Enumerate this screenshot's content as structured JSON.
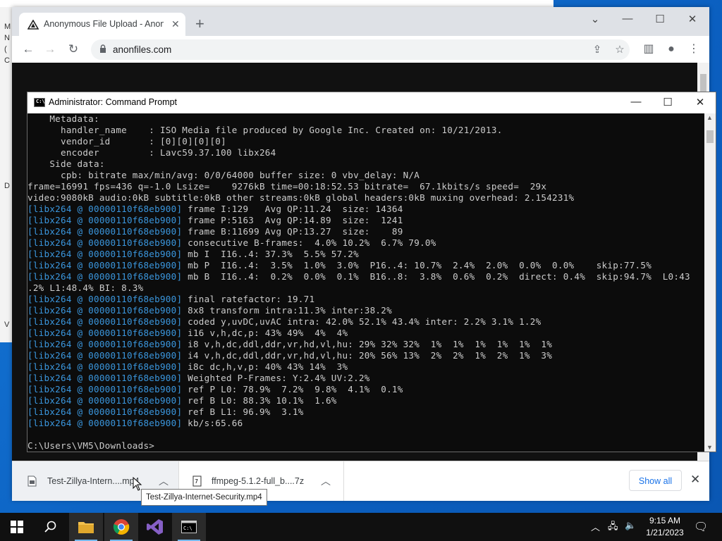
{
  "browser": {
    "tab_title": "Anonymous File Upload - AnonFiles",
    "url": "anonfiles.com",
    "new_tab_label": "+",
    "downloads": [
      {
        "name": "Test-Zillya-Intern....mp4"
      },
      {
        "name": "ffmpeg-5.1.2-full_b....7z"
      }
    ],
    "show_all_label": "Show all",
    "tooltip": "Test-Zillya-Internet-Security.mp4"
  },
  "cmd": {
    "title": "Administrator: Command Prompt",
    "lines": [
      {
        "text": "    Metadata:"
      },
      {
        "text": "      handler_name    : ISO Media file produced by Google Inc. Created on: 10/21/2013."
      },
      {
        "text": "      vendor_id       : [0][0][0][0]"
      },
      {
        "text": "      encoder         : Lavc59.37.100 libx264"
      },
      {
        "text": "    Side data:"
      },
      {
        "text": "      cpb: bitrate max/min/avg: 0/0/64000 buffer size: 0 vbv_delay: N/A"
      },
      {
        "text": "frame=16991 fps=436 q=-1.0 Lsize=    9276kB time=00:18:52.53 bitrate=  67.1kbits/s speed=  29x"
      },
      {
        "text": "video:9080kB audio:0kB subtitle:0kB other streams:0kB global headers:0kB muxing overhead: 2.154231%"
      },
      {
        "prefix": "[libx264 @ 00000110f68eb900]",
        "text": " frame I:129   Avg QP:11.24  size: 14364"
      },
      {
        "prefix": "[libx264 @ 00000110f68eb900]",
        "text": " frame P:5163  Avg QP:14.89  size:  1241"
      },
      {
        "prefix": "[libx264 @ 00000110f68eb900]",
        "text": " frame B:11699 Avg QP:13.27  size:    89"
      },
      {
        "prefix": "[libx264 @ 00000110f68eb900]",
        "text": " consecutive B-frames:  4.0% 10.2%  6.7% 79.0%"
      },
      {
        "prefix": "[libx264 @ 00000110f68eb900]",
        "text": " mb I  I16..4: 37.3%  5.5% 57.2%"
      },
      {
        "prefix": "[libx264 @ 00000110f68eb900]",
        "text": " mb P  I16..4:  3.5%  1.0%  3.0%  P16..4: 10.7%  2.4%  2.0%  0.0%  0.0%    skip:77.5%"
      },
      {
        "prefix": "[libx264 @ 00000110f68eb900]",
        "text": " mb B  I16..4:  0.2%  0.0%  0.1%  B16..8:  3.8%  0.6%  0.2%  direct: 0.4%  skip:94.7%  L0:43"
      },
      {
        "text": ".2% L1:48.4% BI: 8.3%"
      },
      {
        "prefix": "[libx264 @ 00000110f68eb900]",
        "text": " final ratefactor: 19.71"
      },
      {
        "prefix": "[libx264 @ 00000110f68eb900]",
        "text": " 8x8 transform intra:11.3% inter:38.2%"
      },
      {
        "prefix": "[libx264 @ 00000110f68eb900]",
        "text": " coded y,uvDC,uvAC intra: 42.0% 52.1% 43.4% inter: 2.2% 3.1% 1.2%"
      },
      {
        "prefix": "[libx264 @ 00000110f68eb900]",
        "text": " i16 v,h,dc,p: 43% 49%  4%  4%"
      },
      {
        "prefix": "[libx264 @ 00000110f68eb900]",
        "text": " i8 v,h,dc,ddl,ddr,vr,hd,vl,hu: 29% 32% 32%  1%  1%  1%  1%  1%  1%"
      },
      {
        "prefix": "[libx264 @ 00000110f68eb900]",
        "text": " i4 v,h,dc,ddl,ddr,vr,hd,vl,hu: 20% 56% 13%  2%  2%  1%  2%  1%  3%"
      },
      {
        "prefix": "[libx264 @ 00000110f68eb900]",
        "text": " i8c dc,h,v,p: 40% 43% 14%  3%"
      },
      {
        "prefix": "[libx264 @ 00000110f68eb900]",
        "text": " Weighted P-Frames: Y:2.4% UV:2.2%"
      },
      {
        "prefix": "[libx264 @ 00000110f68eb900]",
        "text": " ref P L0: 78.9%  7.2%  9.8%  4.1%  0.1%"
      },
      {
        "prefix": "[libx264 @ 00000110f68eb900]",
        "text": " ref B L0: 88.3% 10.1%  1.6%"
      },
      {
        "prefix": "[libx264 @ 00000110f68eb900]",
        "text": " ref B L1: 96.9%  3.1%"
      },
      {
        "prefix": "[libx264 @ 00000110f68eb900]",
        "text": " kb/s:65.66"
      },
      {
        "text": ""
      },
      {
        "text": "C:\\Users\\VM5\\Downloads>"
      }
    ]
  },
  "taskbar": {
    "time": "9:15 AM",
    "date": "1/21/2023",
    "apps": [
      "start",
      "search",
      "file-explorer",
      "chrome",
      "visual-studio",
      "command-prompt"
    ]
  },
  "desktop_left_chars": [
    "M",
    "N",
    "(",
    "C",
    "D",
    "V"
  ],
  "colors": {
    "console_bg": "#0c0c0c",
    "console_text": "#cccccc",
    "libx264_prefix": "#3a96dd",
    "taskbar": "#101010",
    "link_blue": "#1a73e8"
  }
}
